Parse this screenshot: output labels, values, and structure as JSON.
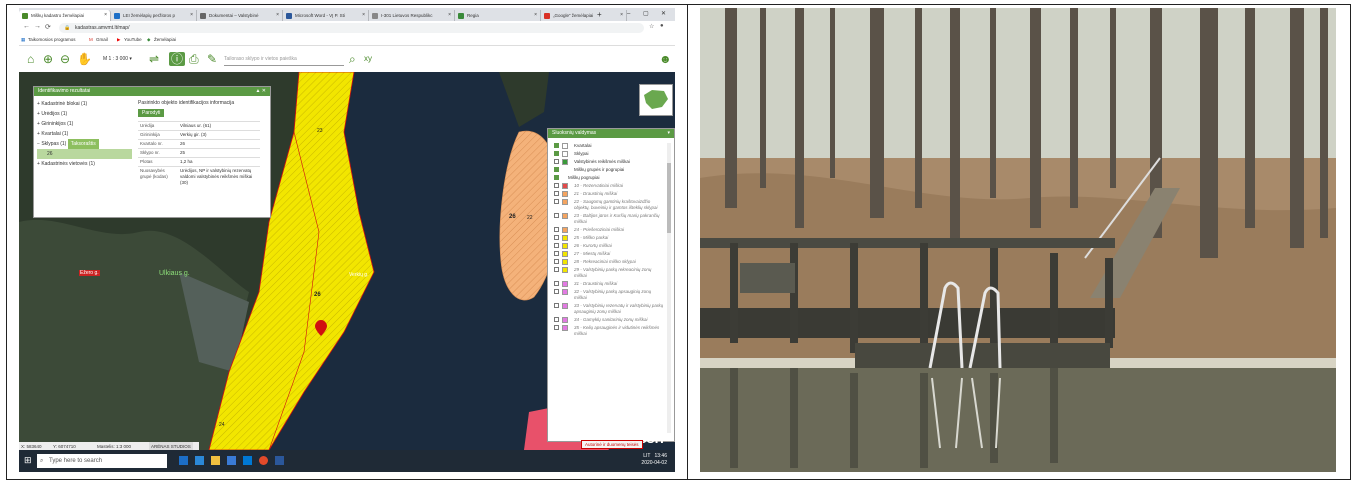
{
  "browser": {
    "tabs": [
      {
        "title": "Miškų kadastro žemėlapiai",
        "color": "#4a8a2a"
      },
      {
        "title": "LEI žemėlapių peržiūros p",
        "color": "#1c6ec7"
      },
      {
        "title": "Dokumentai – Valstybinė",
        "color": "#666666"
      },
      {
        "title": "Microsoft Word - VĮ P. Sti",
        "color": "#2b579a"
      },
      {
        "title": "I-301 Lietuvos Respublikc",
        "color": "#888888"
      },
      {
        "title": "Regia",
        "color": "#3a8a3a"
      },
      {
        "title": "„Google“ žemėlapiai",
        "color": "#d93025"
      }
    ],
    "url": "kadastras.amvmt.lt/map/",
    "bookmarks": [
      "Taikomosios programos",
      "Gmail",
      "YouTube",
      "Žemėlapiai"
    ]
  },
  "toolbar": {
    "scale_label": "M 1 : 3 000",
    "search_placeholder": "Tailoraso sklypo ir vietos paieška"
  },
  "identification_panel": {
    "title": "Identifikavimo rezultatai",
    "list": [
      "Kadastrinė blokai (1)",
      "Urėdijos (1)",
      "Girininkijos (1)",
      "Kvartalai (1)",
      "Sklypas (1)",
      "26",
      "Kadastrinės vietovės (1)"
    ],
    "highlight_label": "Taksoraštis",
    "detail_title": "Pasirinkto objekto identifikacijos informacija",
    "show_button": "Parodyti",
    "rows": [
      {
        "key": "Urėdija",
        "value": "Vilniaus ur. (61)"
      },
      {
        "key": "Girininkija",
        "value": "Verkių gir. (3)"
      },
      {
        "key": "Kvartalo nr.",
        "value": "26"
      },
      {
        "key": "Sklypo nr.",
        "value": "25"
      },
      {
        "key": "Plotas",
        "value": "1,2 ha"
      },
      {
        "key": "Nuosavybės grupė (kodas)",
        "value": "Urėdijos, NP ir valstybinių rezervatų valdomi valstybinės reikšmės miškai (30)"
      }
    ]
  },
  "legend": {
    "title": "Sluoksnių valdymas",
    "items": [
      {
        "label": "Kvartalai",
        "checked": true,
        "swatch": "#ffffff",
        "sub": false
      },
      {
        "label": "Sklypai",
        "checked": true,
        "swatch": "#ffffff",
        "sub": false
      },
      {
        "label": "Valstybinės reikšmės miškai",
        "checked": false,
        "swatch": "#3a9a3a",
        "sub": false
      },
      {
        "label": "Miškų grupės ir pogrupiai",
        "checked": true,
        "swatch": "",
        "sub": false
      },
      {
        "label": "Miškų pogrupiai",
        "checked": true,
        "swatch": "",
        "sub": false
      },
      {
        "label": "10 - Rezervatiniai miškai",
        "checked": false,
        "swatch": "#e24a4a",
        "sub": true
      },
      {
        "label": "21 - Draustinių miškai",
        "checked": false,
        "swatch": "#f4a460",
        "sub": true
      },
      {
        "label": "22 - Saugomų gamtinių kraštovaizdžio objektų, buveinių ir gamtos išteklių sklypai",
        "checked": false,
        "swatch": "#f4a460",
        "sub": true
      },
      {
        "label": "23 - Baltijos jūros ir Kuršių marių pakrančių miškai",
        "checked": false,
        "swatch": "#f4a460",
        "sub": true
      },
      {
        "label": "24 - Priešeroziniai miškai",
        "checked": false,
        "swatch": "#f4a460",
        "sub": true
      },
      {
        "label": "25 - Miško parkai",
        "checked": false,
        "swatch": "#f2e600",
        "sub": true
      },
      {
        "label": "26 - Kurortų miškai",
        "checked": false,
        "swatch": "#f2e600",
        "sub": true
      },
      {
        "label": "27 - Miestų miškai",
        "checked": false,
        "swatch": "#f2e600",
        "sub": true
      },
      {
        "label": "28 - Rekreaciniai miško sklypai",
        "checked": false,
        "swatch": "#f2e600",
        "sub": true
      },
      {
        "label": "29 - Valstybinių parkų rekreacinių zonų miškai",
        "checked": false,
        "swatch": "#f2e600",
        "sub": true
      },
      {
        "label": "31 - Draustinių miškai",
        "checked": false,
        "swatch": "#e27ae2",
        "sub": true
      },
      {
        "label": "32 - Valstybinių parkų apsauginių zonų miškai",
        "checked": false,
        "swatch": "#e27ae2",
        "sub": true
      },
      {
        "label": "33 - Valstybinių rezervatų ir valstybinių parkų apsauginių zonų miškai",
        "checked": false,
        "swatch": "#e27ae2",
        "sub": true
      },
      {
        "label": "34 - Gamyklų sanitarinių zonų miškai",
        "checked": false,
        "swatch": "#e27ae2",
        "sub": true
      },
      {
        "label": "35 - Kelių apsauginės ir vidutinės reikšmės miškai",
        "checked": false,
        "swatch": "#e27ae2",
        "sub": true
      }
    ]
  },
  "map": {
    "labels": [
      {
        "text": "Ežero g.",
        "kind": "road"
      },
      {
        "text": "Ulkiaus g.",
        "kind": "street"
      },
      {
        "text": "Verkių g.",
        "kind": "street"
      },
      {
        "text": "26",
        "kind": "parcel"
      },
      {
        "text": "26",
        "kind": "parcel"
      },
      {
        "text": "22",
        "kind": "parcel"
      },
      {
        "text": "23",
        "kind": "parcel"
      },
      {
        "text": "24",
        "kind": "parcel"
      }
    ],
    "coords": {
      "x": "X: 583640",
      "y": "Y: 6074710",
      "scale": "Mastelis: 1:3 000",
      "status": "ARÉNAS STUDIOS"
    },
    "author_link": "Autorinė ir duomenų teisės",
    "brand": "esri"
  },
  "taskbar": {
    "search_placeholder": "Type here to search",
    "time": "13:46",
    "date": "2020-04-02",
    "lang": "LIT"
  },
  "colors": {
    "accent": "#5b9a44",
    "yellow_zone": "#f2e600",
    "orange_zone": "#f4b27a",
    "water": "#1b2b3e"
  },
  "photo": {
    "subject": "wooden dock with ladder on a lake, forest and stairs in background"
  }
}
